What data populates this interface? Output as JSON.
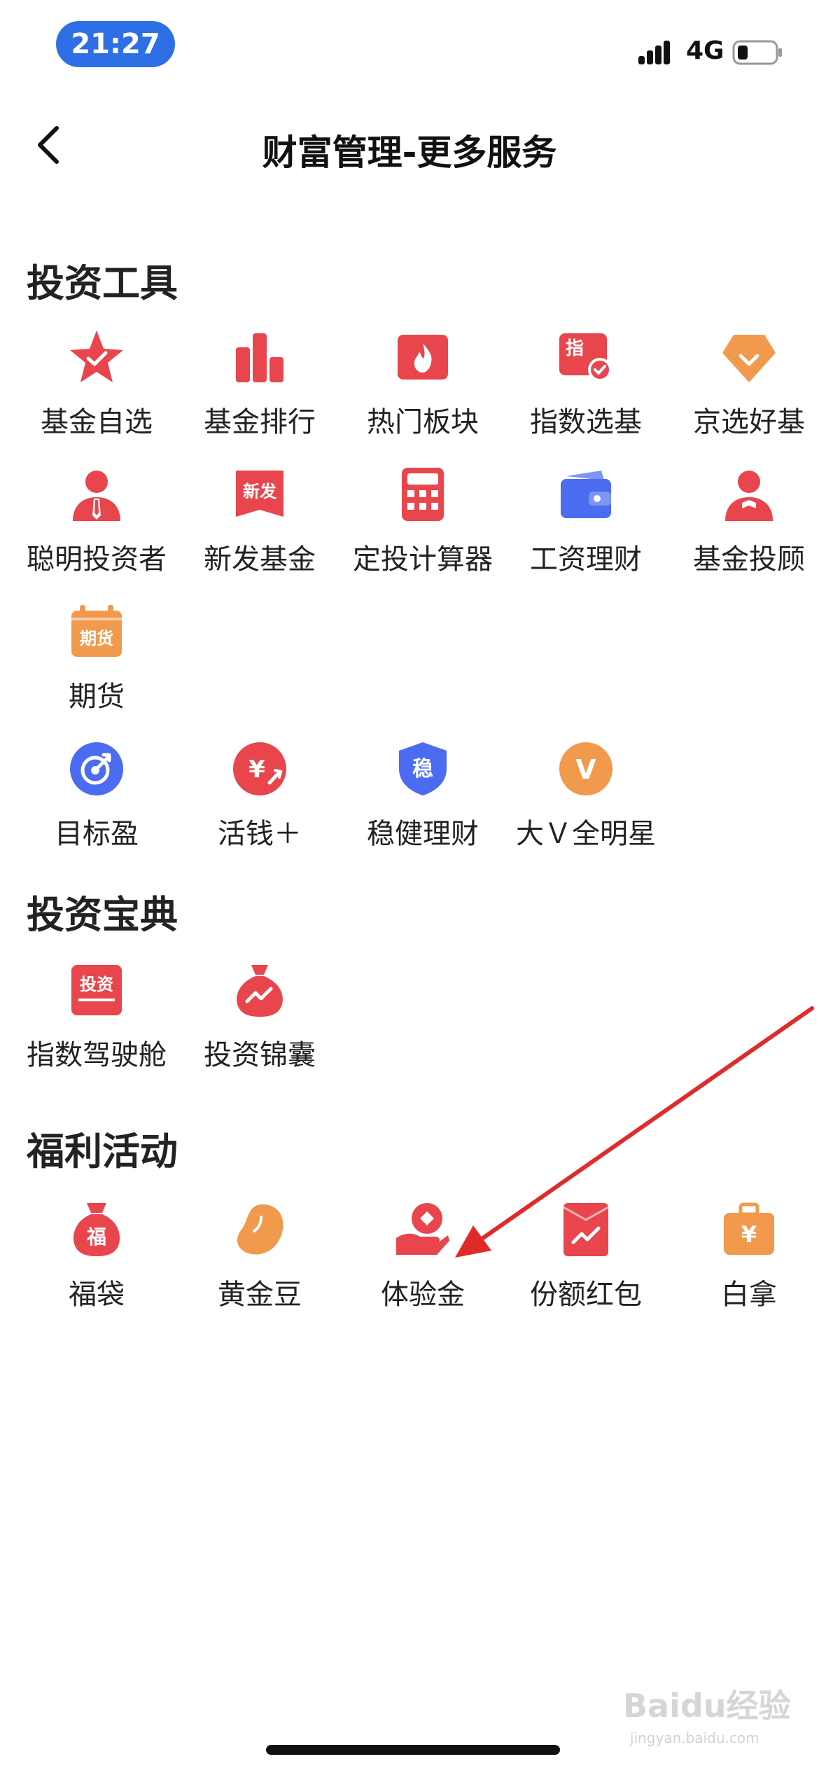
{
  "status_bar": {
    "time": "21:27",
    "network": "4G"
  },
  "nav": {
    "title": "财富管理-更多服务"
  },
  "sections": [
    {
      "title": "投资工具",
      "items": [
        {
          "label": "基金自选",
          "icon": "star-check-icon"
        },
        {
          "label": "基金排行",
          "icon": "bar-chart-icon"
        },
        {
          "label": "热门板块",
          "icon": "flame-icon"
        },
        {
          "label": "指数选基",
          "icon": "index-check-icon"
        },
        {
          "label": "京选好基",
          "icon": "gem-check-icon"
        },
        {
          "label": "聪明投资者",
          "icon": "investor-person-icon"
        },
        {
          "label": "新发基金",
          "icon": "new-badge-icon"
        },
        {
          "label": "定投计算器",
          "icon": "calculator-icon"
        },
        {
          "label": "工资理财",
          "icon": "wallet-icon"
        },
        {
          "label": "基金投顾",
          "icon": "advisor-person-icon"
        },
        {
          "label": "期货",
          "icon": "futures-calendar-icon"
        },
        {
          "label": "目标盈",
          "icon": "target-icon"
        },
        {
          "label": "活钱＋",
          "icon": "yuan-circle-icon"
        },
        {
          "label": "稳健理财",
          "icon": "shield-stable-icon"
        },
        {
          "label": "大Ｖ全明星",
          "icon": "v-circle-icon"
        }
      ]
    },
    {
      "title": "投资宝典",
      "items": [
        {
          "label": "指数驾驶舱",
          "icon": "invest-book-icon"
        },
        {
          "label": "投资锦囊",
          "icon": "money-bag-icon"
        }
      ]
    },
    {
      "title": "福利活动",
      "items": [
        {
          "label": "福袋",
          "icon": "lucky-bag-icon"
        },
        {
          "label": "黄金豆",
          "icon": "golden-bean-icon"
        },
        {
          "label": "体验金",
          "icon": "hand-coin-icon"
        },
        {
          "label": "份额红包",
          "icon": "red-envelope-icon"
        },
        {
          "label": "白拿",
          "icon": "briefcase-yuan-icon"
        }
      ]
    }
  ],
  "icon_text": {
    "index": "指",
    "new": "新发",
    "futures": "期货",
    "invest": "投资",
    "stable": "稳",
    "v": "V",
    "fu": "福",
    "yuan": "¥"
  },
  "colors": {
    "accent_red": "#e8454d",
    "blue": "#4b6cf0",
    "orange": "#f19a4d",
    "status_blue": "#2f6fe6"
  },
  "watermark": {
    "text": "Baidu经验",
    "sub": "jingyan.baidu.com"
  }
}
